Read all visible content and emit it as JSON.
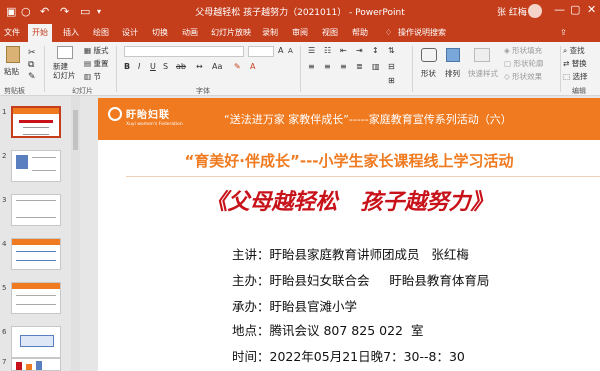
{
  "titlebar": {
    "title": "父母越轻松 孩子越努力（2021011） - PowerPoint",
    "user": "张 红梅"
  },
  "tabs": [
    "文件",
    "开始",
    "插入",
    "绘图",
    "设计",
    "切换",
    "动画",
    "幻灯片放映",
    "录制",
    "审阅",
    "视图",
    "帮助",
    "操作说明搜索"
  ],
  "active_tab": "开始",
  "ribbon": {
    "paste": "粘贴",
    "new_slide": "新建\n幻灯片",
    "layout": "版式",
    "reset": "重置",
    "section": "节",
    "font_group": "字体",
    "clipboard_group": "剪贴板",
    "slides_group": "幻灯片",
    "shape": "形状",
    "arrange": "排列",
    "quick_styles": "快速样式",
    "shape_fill": "形状填充",
    "shape_outline": "形状轮廓",
    "shape_effects": "形状效果",
    "find": "查找",
    "replace": "替换",
    "select": "选择",
    "editing_group": "编辑"
  },
  "thumbnails": [
    "1",
    "2",
    "3",
    "4",
    "5",
    "6",
    "7"
  ],
  "slide": {
    "logo_cn": "盱眙妇联",
    "logo_en": "Xuyi women's Federation",
    "band_text": "“送法进万家   家教伴成长”-----家庭教育宣传系列活动（六）",
    "subtitle": "“育美好·伴成长”---小学生家长课程线上学习活动",
    "main_title": "《父母越轻松   孩子越努力》",
    "lines": [
      "主讲：盱眙县家庭教育讲师团成员   张红梅",
      "主办：盱眙县妇女联合会     盱眙县教育体育局",
      "承办：盱眙县官滩小学",
      "地点：腾讯会议 807 825 022  室",
      "时间：2022年05月21日晚7：30--8：30"
    ]
  },
  "colors": {
    "accent": "#c43e1c",
    "band": "#ef7a1f",
    "title_red": "#c8121a"
  }
}
